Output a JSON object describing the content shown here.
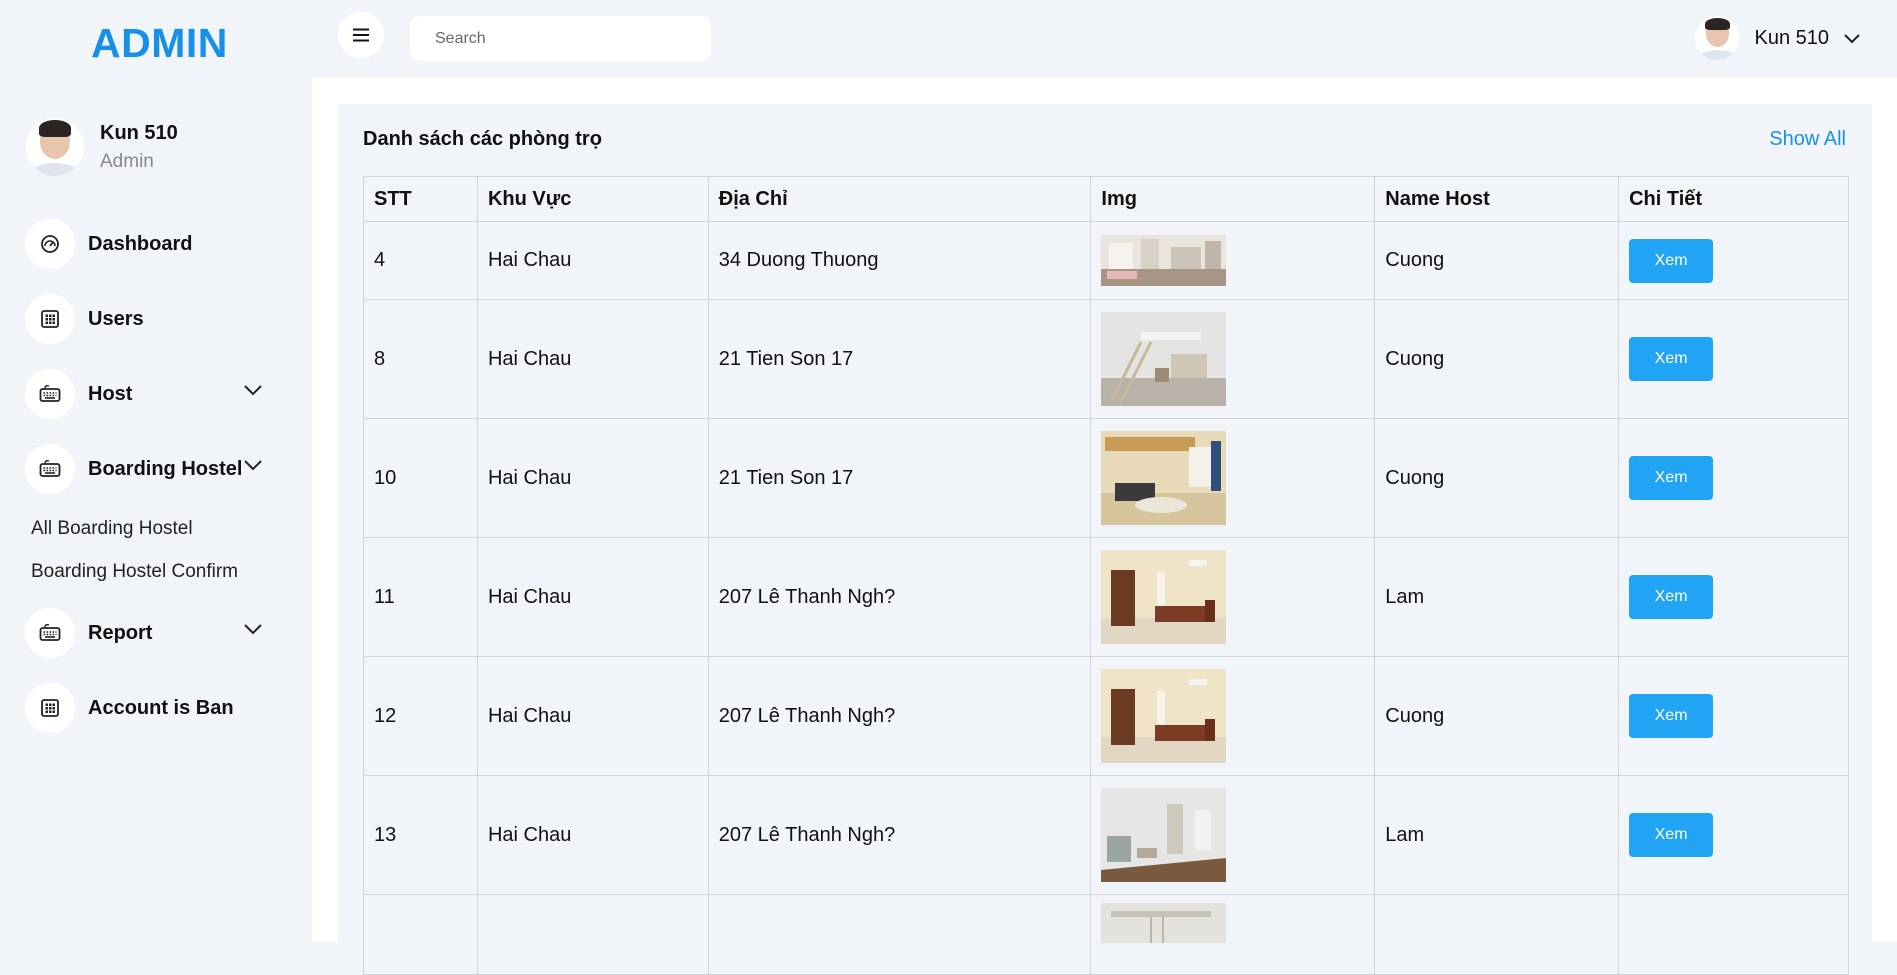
{
  "brand": "ADMIN",
  "profile": {
    "name": "Kun 510",
    "role": "Admin"
  },
  "nav": {
    "dashboard": "Dashboard",
    "users": "Users",
    "host": "Host",
    "boarding": "Boarding Hostel",
    "boarding_sub": [
      "All Boarding Hostel",
      "Boarding Hostel Confirm"
    ],
    "report": "Report",
    "account_ban": "Account is Ban"
  },
  "search": {
    "placeholder": "Search",
    "value": ""
  },
  "user_menu": {
    "name": "Kun 510"
  },
  "card": {
    "title": "Danh sách các phòng trọ",
    "show_all": "Show All"
  },
  "table": {
    "headers": [
      "STT",
      "Khu Vực",
      "Địa Chỉ",
      "Img",
      "Name Host",
      "Chi Tiết"
    ],
    "rows": [
      {
        "stt": "4",
        "khu_vuc": "Hai Chau",
        "dia_chi": "34 Duong Thuong",
        "host": "Cuong",
        "action": "Xem"
      },
      {
        "stt": "8",
        "khu_vuc": "Hai Chau",
        "dia_chi": "21 Tien Son 17",
        "host": "Cuong",
        "action": "Xem"
      },
      {
        "stt": "10",
        "khu_vuc": "Hai Chau",
        "dia_chi": "21 Tien Son 17",
        "host": "Cuong",
        "action": "Xem"
      },
      {
        "stt": "11",
        "khu_vuc": "Hai Chau",
        "dia_chi": "207 Lê Thanh Ngh?",
        "host": "Lam",
        "action": "Xem"
      },
      {
        "stt": "12",
        "khu_vuc": "Hai Chau",
        "dia_chi": "207 Lê Thanh Ngh?",
        "host": "Cuong",
        "action": "Xem"
      },
      {
        "stt": "13",
        "khu_vuc": "Hai Chau",
        "dia_chi": "207 Lê Thanh Ngh?",
        "host": "Lam",
        "action": "Xem"
      }
    ]
  },
  "colors": {
    "accent": "#1890e8",
    "button": "#22a4f4",
    "background": "#f1f4f8"
  }
}
